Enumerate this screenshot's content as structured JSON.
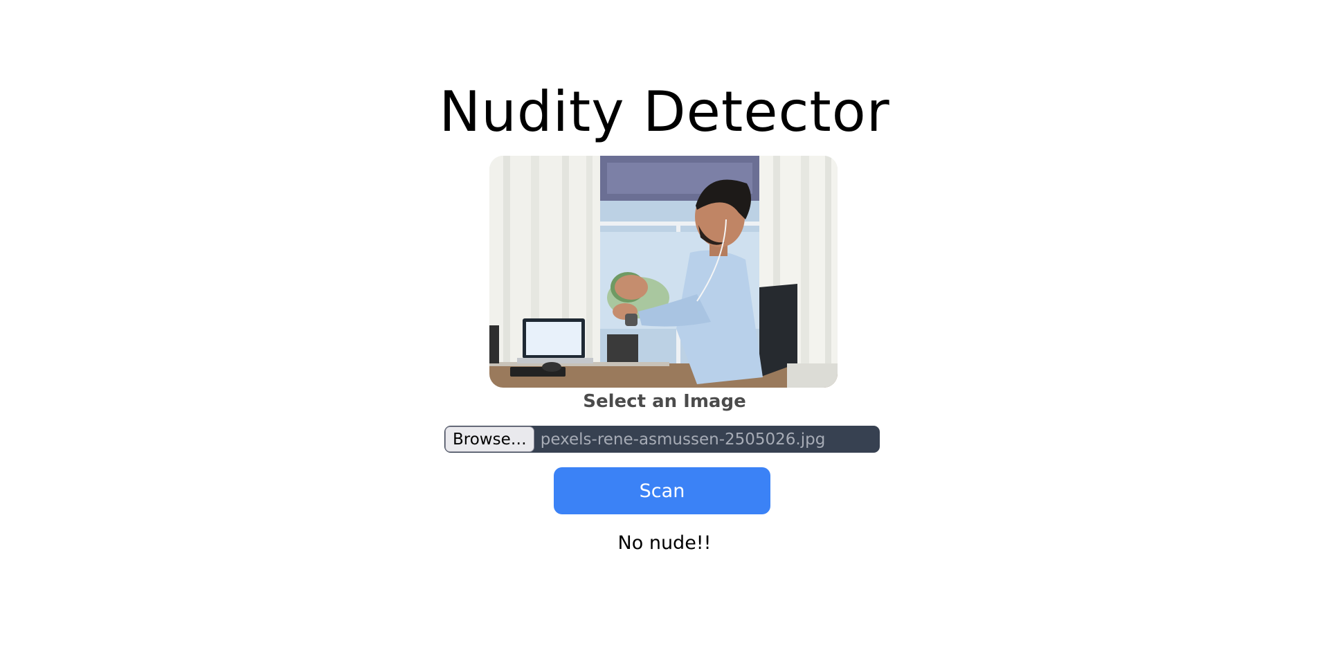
{
  "title": "Nudity Detector",
  "preview": {
    "image_semantic": "office-man-photo"
  },
  "upload": {
    "label": "Select an Image",
    "browse_label": "Browse…",
    "file_name": "pexels-rene-asmussen-2505026.jpg"
  },
  "scan_button": {
    "label": "Scan"
  },
  "result": {
    "text": "No nude!!"
  },
  "colors": {
    "scan_button_bg": "#3b82f6",
    "file_input_bg": "#374151",
    "label_text": "#4b4b4b"
  }
}
